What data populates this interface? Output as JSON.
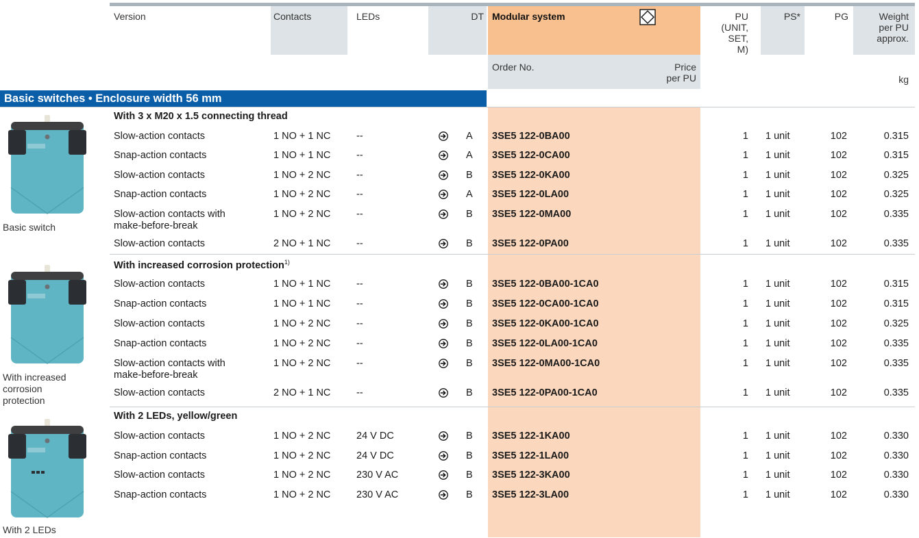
{
  "header": {
    "version": "Version",
    "contacts": "Contacts",
    "leds": "LEDs",
    "dt": "DT",
    "modular": "Modular system",
    "order_no": "Order No.",
    "price": "Price per PU",
    "pu": "PU (UNIT, SET, M)",
    "ps": "PS*",
    "pg": "PG",
    "weight": "Weight per PU approx.",
    "kg": "kg"
  },
  "section_title": "Basic switches • Enclosure width 56 mm",
  "groups": [
    {
      "title": "With 3 x M20 x 1.5 connecting thread",
      "footnote": "",
      "photo_caption": "Basic switch",
      "rows": [
        {
          "version": "Slow-action contacts",
          "contacts": "1 NO + 1 NC",
          "leds": "--",
          "dt": "A",
          "order": "3SE5 122-0BA00",
          "pu": "1",
          "ps": "1 unit",
          "pg": "102",
          "weight": "0.315"
        },
        {
          "version": "Snap-action contacts",
          "contacts": "1 NO + 1 NC",
          "leds": "--",
          "dt": "A",
          "order": "3SE5 122-0CA00",
          "pu": "1",
          "ps": "1 unit",
          "pg": "102",
          "weight": "0.315"
        },
        {
          "version": "Slow-action contacts",
          "contacts": "1 NO + 2 NC",
          "leds": "--",
          "dt": "B",
          "order": "3SE5 122-0KA00",
          "pu": "1",
          "ps": "1 unit",
          "pg": "102",
          "weight": "0.325"
        },
        {
          "version": "Snap-action contacts",
          "contacts": "1 NO + 2 NC",
          "leds": "--",
          "dt": "A",
          "order": "3SE5 122-0LA00",
          "pu": "1",
          "ps": "1 unit",
          "pg": "102",
          "weight": "0.325"
        },
        {
          "version": "Slow-action contacts with",
          "version2": "make-before-break",
          "contacts": "1 NO + 2 NC",
          "leds": "--",
          "dt": "B",
          "order": "3SE5 122-0MA00",
          "pu": "1",
          "ps": "1 unit",
          "pg": "102",
          "weight": "0.335"
        },
        {
          "version": "Slow-action contacts",
          "contacts": "2 NO + 1 NC",
          "leds": "--",
          "dt": "B",
          "order": "3SE5 122-0PA00",
          "pu": "1",
          "ps": "1 unit",
          "pg": "102",
          "weight": "0.335"
        }
      ]
    },
    {
      "title": "With increased corrosion protection",
      "footnote": "1)",
      "photo_caption": "With increased corrosion protection",
      "rows": [
        {
          "version": "Slow-action contacts",
          "contacts": "1 NO + 1 NC",
          "leds": "--",
          "dt": "B",
          "order": "3SE5 122-0BA00-1CA0",
          "pu": "1",
          "ps": "1 unit",
          "pg": "102",
          "weight": "0.315"
        },
        {
          "version": "Snap-action contacts",
          "contacts": "1 NO + 1 NC",
          "leds": "--",
          "dt": "B",
          "order": "3SE5 122-0CA00-1CA0",
          "pu": "1",
          "ps": "1 unit",
          "pg": "102",
          "weight": "0.315"
        },
        {
          "version": "Slow-action contacts",
          "contacts": "1 NO + 2 NC",
          "leds": "--",
          "dt": "B",
          "order": "3SE5 122-0KA00-1CA0",
          "pu": "1",
          "ps": "1 unit",
          "pg": "102",
          "weight": "0.325"
        },
        {
          "version": "Snap-action contacts",
          "contacts": "1 NO + 2 NC",
          "leds": "--",
          "dt": "B",
          "order": "3SE5 122-0LA00-1CA0",
          "pu": "1",
          "ps": "1 unit",
          "pg": "102",
          "weight": "0.335"
        },
        {
          "version": "Slow-action contacts with",
          "version2": "make-before-break",
          "contacts": "1 NO + 2 NC",
          "leds": "--",
          "dt": "B",
          "order": "3SE5 122-0MA00-1CA0",
          "pu": "1",
          "ps": "1 unit",
          "pg": "102",
          "weight": "0.335"
        },
        {
          "version": "Slow-action contacts",
          "contacts": "2 NO + 1 NC",
          "leds": "--",
          "dt": "B",
          "order": "3SE5 122-0PA00-1CA0",
          "pu": "1",
          "ps": "1 unit",
          "pg": "102",
          "weight": "0.335"
        }
      ]
    },
    {
      "title": "With 2 LEDs, yellow/green",
      "footnote": "",
      "photo_caption": "With 2 LEDs",
      "rows": [
        {
          "version": "Slow-action contacts",
          "contacts": "1 NO + 2 NC",
          "leds": "24 V DC",
          "dt": "B",
          "order": "3SE5 122-1KA00",
          "pu": "1",
          "ps": "1 unit",
          "pg": "102",
          "weight": "0.330"
        },
        {
          "version": "Snap-action contacts",
          "contacts": "1 NO + 2 NC",
          "leds": "24 V DC",
          "dt": "B",
          "order": "3SE5 122-1LA00",
          "pu": "1",
          "ps": "1 unit",
          "pg": "102",
          "weight": "0.330"
        },
        {
          "version": "Slow-action contacts",
          "contacts": "1 NO + 2 NC",
          "leds": "230 V AC",
          "dt": "B",
          "order": "3SE5 122-3KA00",
          "pu": "1",
          "ps": "1 unit",
          "pg": "102",
          "weight": "0.330"
        },
        {
          "version": "Snap-action contacts",
          "contacts": "1 NO + 2 NC",
          "leds": "230 V AC",
          "dt": "B",
          "order": "3SE5 122-3LA00",
          "pu": "1",
          "ps": "1 unit",
          "pg": "102",
          "weight": "0.330"
        }
      ]
    }
  ],
  "colors": {
    "header_bar": "#a9b4bd",
    "header_shade": "#dde3e7",
    "modular_header": "#f9c08f",
    "modular_column": "#fbd8bd",
    "section_band": "#0a5ea8",
    "device_body": "#5fb5c4",
    "device_dark": "#2b2f33"
  }
}
